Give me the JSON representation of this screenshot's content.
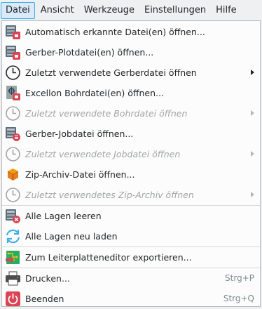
{
  "menubar": {
    "items": [
      {
        "label": "Datei",
        "active": true
      },
      {
        "label": "Ansicht"
      },
      {
        "label": "Werkzeuge"
      },
      {
        "label": "Einstellungen"
      },
      {
        "label": "Hilfe"
      }
    ]
  },
  "menu": {
    "items": [
      {
        "label": "Automatisch erkannte Datei(en) öffnen...",
        "icon": "gerber-open-icon",
        "enabled": true
      },
      {
        "label": "Gerber-Plotdatei(en) öffnen...",
        "icon": "gerber-plot-icon",
        "enabled": true
      },
      {
        "label": "Zuletzt verwendete Gerberdatei öffnen",
        "icon": "clock-icon",
        "enabled": true,
        "submenu": true
      },
      {
        "label": "Excellon Bohrdatei(en) öffnen...",
        "icon": "drill-file-icon",
        "enabled": true
      },
      {
        "label": "Zuletzt verwendete Bohrdatei öffnen",
        "icon": "clock-icon",
        "enabled": false,
        "submenu": true
      },
      {
        "label": "Gerber-Jobdatei öffnen...",
        "icon": "job-file-icon",
        "enabled": true
      },
      {
        "label": "Zuletzt verwendete Jobdatei öffnen",
        "icon": "clock-icon",
        "enabled": false,
        "submenu": true
      },
      {
        "label": "Zip-Archiv-Datei öffnen...",
        "icon": "archive-icon",
        "enabled": true
      },
      {
        "label": "Zuletzt verwendetes Zip-Archiv öffnen",
        "icon": "clock-icon",
        "enabled": false,
        "submenu": true
      },
      {
        "label": "Alle Lagen leeren",
        "icon": "clear-layers-icon",
        "enabled": true
      },
      {
        "label": "Alle Lagen neu laden",
        "icon": "reload-icon",
        "enabled": true
      },
      {
        "label": "Zum Leiterplatteneditor exportieren...",
        "icon": "export-pcb-icon",
        "enabled": true
      },
      {
        "label": "Drucken...",
        "icon": "printer-icon",
        "enabled": true,
        "shortcut": "Strg+P"
      },
      {
        "label": "Beenden",
        "icon": "quit-icon",
        "enabled": true,
        "shortcut": "Strg+Q"
      }
    ]
  },
  "colors": {
    "accent": "#3daee9",
    "menubar_active_bg": "#d9eaf8",
    "disabled_text": "#a2a4a6",
    "badge_red": "#da4453"
  }
}
